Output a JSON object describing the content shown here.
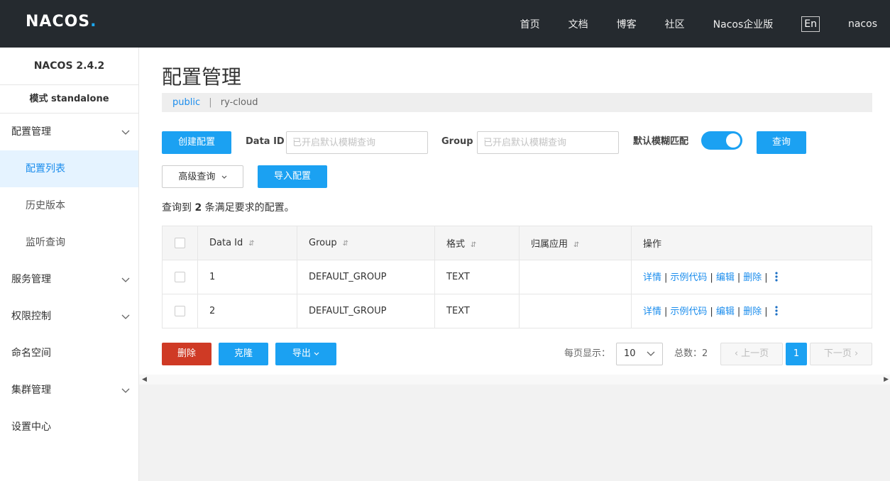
{
  "header": {
    "logo": "NACOS",
    "logo_dot": ".",
    "nav": [
      "首页",
      "文档",
      "博客",
      "社区",
      "Nacos企业版"
    ],
    "lang": "En",
    "user": "nacos"
  },
  "sidebar": {
    "version": "NACOS 2.4.2",
    "mode": "模式 standalone",
    "items": [
      {
        "label": "配置管理"
      },
      {
        "label": "配置列表"
      },
      {
        "label": "历史版本"
      },
      {
        "label": "监听查询"
      },
      {
        "label": "服务管理"
      },
      {
        "label": "权限控制"
      },
      {
        "label": "命名空间"
      },
      {
        "label": "集群管理"
      },
      {
        "label": "设置中心"
      }
    ]
  },
  "main": {
    "title": "配置管理",
    "namespace_active": "public",
    "separator": "|",
    "namespace_other": "ry-cloud"
  },
  "toolbar": {
    "create_label": "创建配置",
    "dataid_label": "Data ID",
    "dataid_placeholder": "已开启默认模糊查询",
    "group_label": "Group",
    "group_placeholder": "已开启默认模糊查询",
    "fuzzy_label": "默认模糊匹配",
    "fuzzy_on": true,
    "query_label": "查询",
    "advanced_label": "高级查询",
    "import_label": "导入配置"
  },
  "result": {
    "prefix": "查询到",
    "count": "2",
    "suffix": "条满足要求的配置。"
  },
  "table": {
    "headers": [
      "Data Id",
      "Group",
      "格式",
      "归属应用",
      "操作"
    ],
    "rows": [
      {
        "data_id": "1",
        "group": "DEFAULT_GROUP",
        "format": "TEXT",
        "app": ""
      },
      {
        "data_id": "2",
        "group": "DEFAULT_GROUP",
        "format": "TEXT",
        "app": ""
      }
    ],
    "ops": [
      "详情",
      "示例代码",
      "编辑",
      "删除"
    ]
  },
  "footer": {
    "delete_label": "删除",
    "clone_label": "克隆",
    "export_label": "导出",
    "page_size_label": "每页显示：",
    "page_size": "10",
    "total_label": "总数：2",
    "prev_label": "上一页",
    "current_page": "1",
    "next_label": "下一页"
  },
  "colors": {
    "header_bg": "#252a2f",
    "primary": "#1ba1f2",
    "danger": "#cf3a25",
    "link": "#1b8ded"
  }
}
